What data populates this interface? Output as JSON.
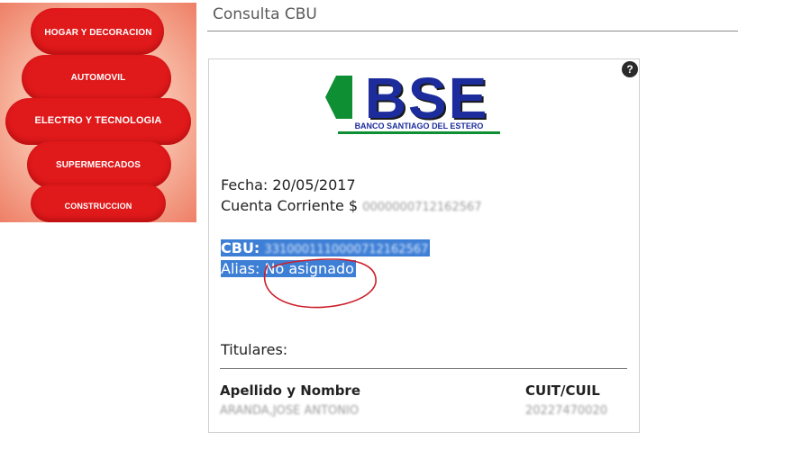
{
  "categories": [
    "HOGAR Y DECORACION",
    "AUTOMOVIL",
    "ELECTRO Y TECNOLOGIA",
    "SUPERMERCADOS",
    "CONSTRUCCION"
  ],
  "page": {
    "title": "Consulta CBU"
  },
  "logo": {
    "name": "BSE",
    "subtitle": "BANCO SANTIAGO DEL ESTERO"
  },
  "help": {
    "label": "?"
  },
  "account": {
    "fecha_label": "Fecha:",
    "fecha": "20/05/2017",
    "cuenta_label": "Cuenta Corriente $",
    "cuenta_number": "0000000712162567",
    "cbu_label": "CBU:",
    "cbu": "3310001110000712162567",
    "alias_label": "Alias:",
    "alias": "No asignado"
  },
  "holders": {
    "title": "Titulares:",
    "col_name": "Apellido y Nombre",
    "col_cuit": "CUIT/CUIL",
    "name": "ARANDA,JOSE ANTONIO",
    "cuit": "20227470020"
  },
  "colors": {
    "category_red": "#e0191b",
    "selection_blue": "#3e7fd6",
    "logo_blue": "#1c2c9c",
    "logo_green": "#0f8f34",
    "annotation_red": "#cc1f2a"
  }
}
